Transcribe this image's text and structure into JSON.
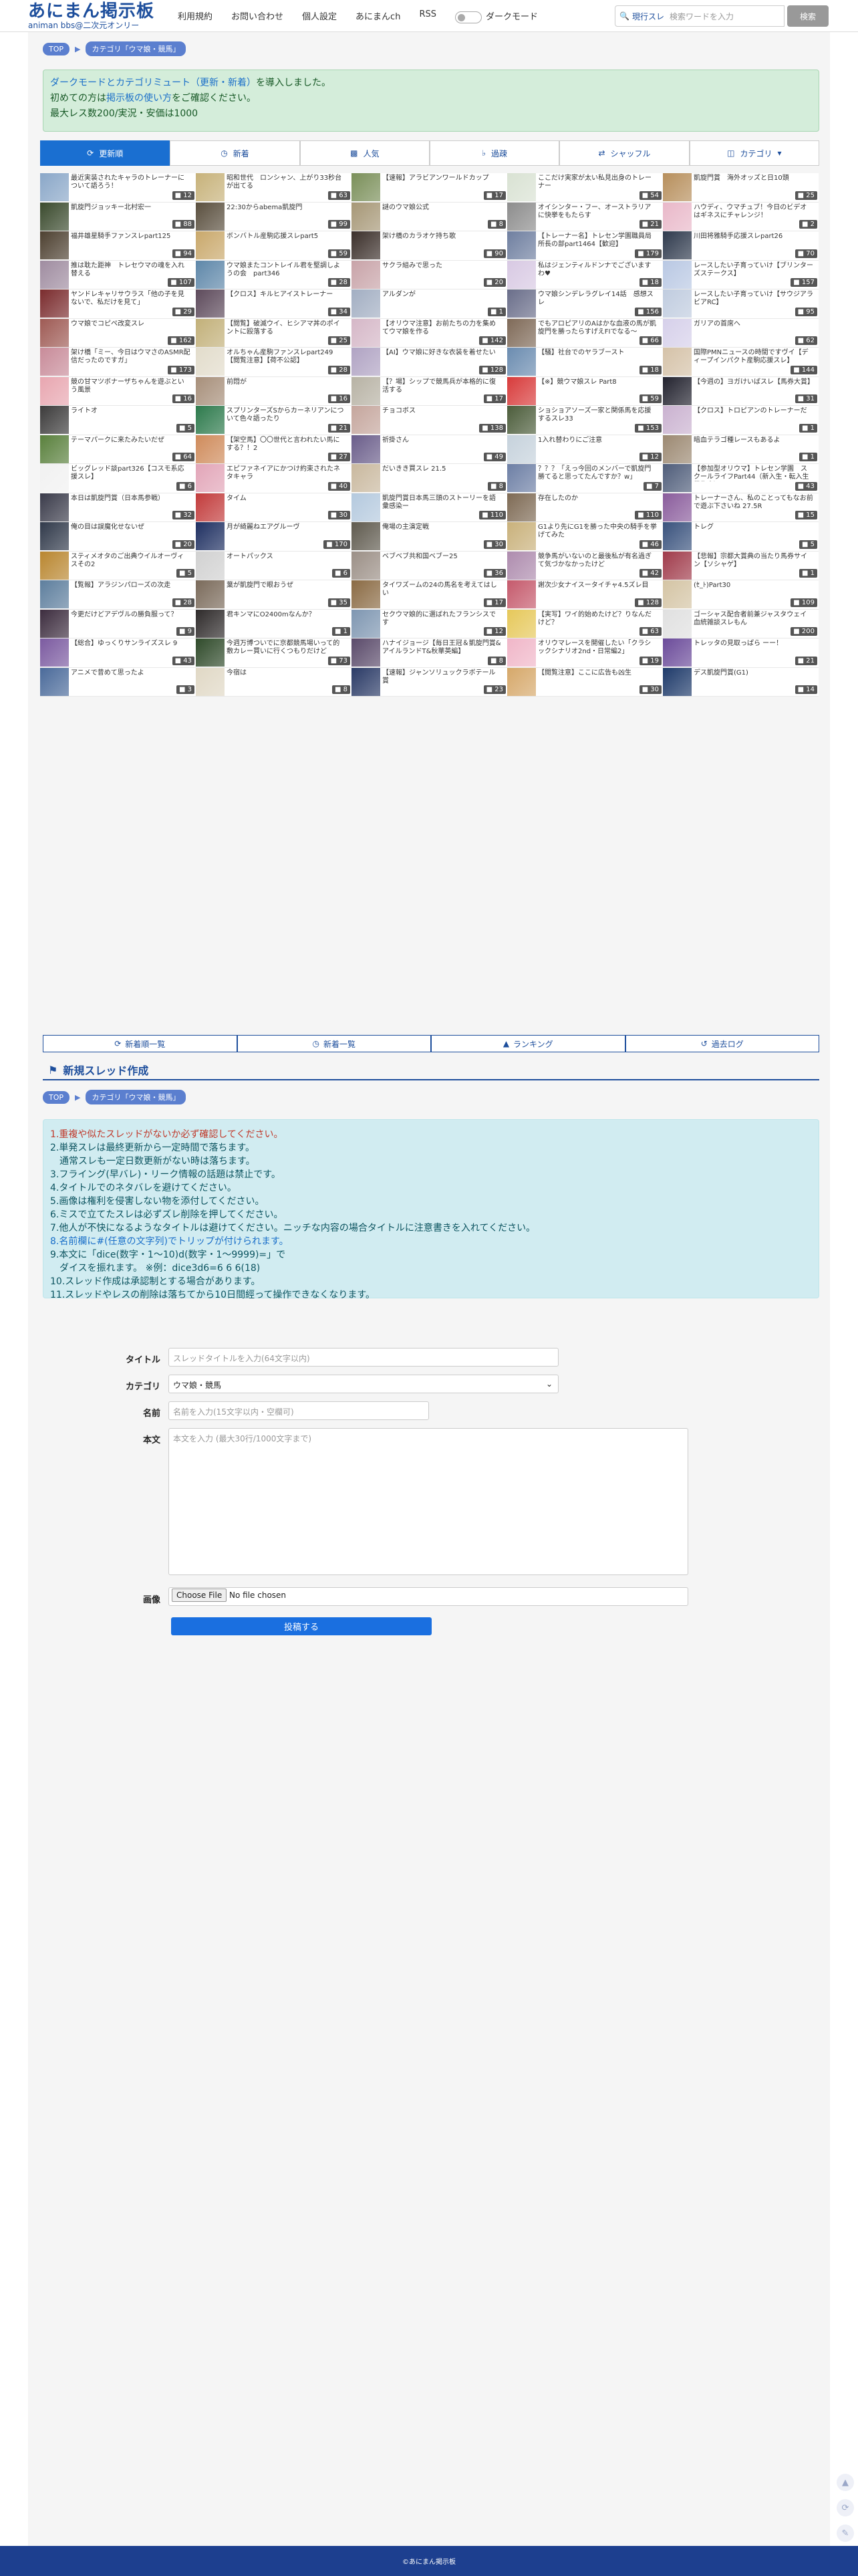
{
  "header": {
    "logo_title": "あにまん掲示板",
    "logo_sub": "animan bbs@二次元オンリー",
    "nav": [
      "利用規約",
      "お問い合わせ",
      "個人設定",
      "あにまんch",
      "RSS"
    ],
    "dark_mode": "ダークモード",
    "search_mode": "現行スレ",
    "search_placeholder": "検索ワードを入力",
    "search_button": "検索"
  },
  "breadcrumb": {
    "top": "TOP",
    "category": "カテゴリ「ウマ娘・競馬」"
  },
  "notice": {
    "l1a": "ダークモードとカテゴリミュート（更新・新着）",
    "l1b": "を導入しました。",
    "l2a": "初めての方は",
    "l2b": "掲示板の使い方",
    "l2c": "をご確認ください。",
    "l3": "最大レス数200/実況・安価は1000"
  },
  "tabs": [
    "更新順",
    "新着",
    "人気",
    "過疎",
    "シャッフル",
    "カテゴリ"
  ],
  "threads": [
    {
      "t": "最近実装されたキャラのトレーナーについて語ろう！",
      "c": "12",
      "h": "#8aa7c8"
    },
    {
      "t": "昭和世代　ロンシャン、上がり33秒台が出てる",
      "c": "63",
      "h": "#c7b27a"
    },
    {
      "t": "【速報】アラビアンワールドカップ",
      "c": "17",
      "h": "#7a8f59"
    },
    {
      "t": "ここだけ実家が太い私見出身のトレーナー",
      "c": "54",
      "h": "#d9e2d3"
    },
    {
      "t": "凱旋門賞　海外オッズと日10頭",
      "c": "25",
      "h": "#b78f5c"
    },
    {
      "t": "凱旋門ジョッキー北村宏一",
      "c": "88",
      "h": "#3a4a2d"
    },
    {
      "t": "22:30からabema凱旋門",
      "c": "99",
      "h": "#5a4f3e"
    },
    {
      "t": "謎のウマ娘公式",
      "c": "8",
      "h": "#a69776"
    },
    {
      "t": "オイシンター・フー、オーストラリアに快挙をもたらす",
      "c": "21",
      "h": "#8d8d8d"
    },
    {
      "t": "ハウディ、ウマチュブ！今日のビデオはギネスにチャレンジ！",
      "c": "2",
      "h": "#e9b8c9"
    },
    {
      "t": "福井雄星騎手ファンスレpart125",
      "c": "94",
      "h": "#4d4030"
    },
    {
      "t": "ボンバトル産駒応援スレpart5",
      "c": "59",
      "h": "#c9a86b"
    },
    {
      "t": "架け橋のカラオケ持ち歌",
      "c": "90",
      "h": "#3b2f2a"
    },
    {
      "t": "【トレーナー名】トレセン学園職員局所長の部part1464【歓迎】",
      "c": "179",
      "h": "#6f7fa0"
    },
    {
      "t": "川田将雅騎手応援スレpart26",
      "c": "70",
      "h": "#2f3a4d"
    },
    {
      "t": "推は耽た距神　トレセウマの魂を入れ替える",
      "c": "107",
      "h": "#9f8ca0"
    },
    {
      "t": "ウマ娘またコントレイル君を堅調しようの会　part346",
      "c": "28",
      "h": "#5e87a9"
    },
    {
      "t": "サクラ組みで思った",
      "c": "20",
      "h": "#c8a3a8"
    },
    {
      "t": "私はジェンティルドンナでございますわ♥",
      "c": "18",
      "h": "#d8c9e3"
    },
    {
      "t": "レースしたい子育っていけ【ブリンターズステークス】",
      "c": "157",
      "h": "#b9c8e3"
    },
    {
      "t": "ヤンドレキャリサウラス「他の子を見ないで、私だけを見て」",
      "c": "29",
      "h": "#7a2b2d"
    },
    {
      "t": "【クロス】キルヒアイストレーナー",
      "c": "34",
      "h": "#5d4a5b"
    },
    {
      "t": "アルダンが",
      "c": "1",
      "h": "#a2aec2"
    },
    {
      "t": "ウマ娘シンデレラグレイ14話　感想スレ",
      "c": "156",
      "h": "#6a6e8a"
    },
    {
      "t": "レースしたい子育っていけ【サウジアラビアRC】",
      "c": "95",
      "h": "#c0ccdf"
    },
    {
      "t": "ウマ娘でコピペ改変スレ",
      "c": "162",
      "h": "#9e5a54"
    },
    {
      "t": "【閲覧】破滅ウイ、ヒシアマ丼のポイントに殴落する",
      "c": "25",
      "h": "#c2b079"
    },
    {
      "t": "【オリウマ注意】お前たちの力を集めてウマ娘を作る",
      "c": "142",
      "h": "#d5b7c7"
    },
    {
      "t": "でもアロピアリのAはかな血液の馬が凱旋門を勝ったらすげえFIでなる～",
      "c": "66",
      "h": "#7f6a58"
    },
    {
      "t": "ガリアの首席へ",
      "c": "62",
      "h": "#d6d0ea"
    },
    {
      "t": "架け橋「ミー、今日はウマさのASMR配信だったのですガ」",
      "c": "173",
      "h": "#c88b99"
    },
    {
      "t": "オルちゃん産駒ファンスレpart249【閲覧注意】【荷不公認】",
      "c": "28",
      "h": "#e2dccb"
    },
    {
      "t": "【AI】ウマ娘に好きな衣装を着せたい",
      "c": "128",
      "h": "#b0a3c3"
    },
    {
      "t": "【騒】社台でのヤラブースト",
      "c": "18",
      "h": "#6b8cb0"
    },
    {
      "t": "国際PMNニュースの時間ですヴイ【ディープインパクト産駒応援スレ】 part103",
      "c": "144",
      "h": "#d5c2a8"
    },
    {
      "t": "競の甘マツボナーザちゃんを遊ぶという風景",
      "c": "16",
      "h": "#e8a6b0"
    },
    {
      "t": "前悶が",
      "c": "16",
      "h": "#a78f7a"
    },
    {
      "t": "【？場】シップで競馬兵が本格的に復活する",
      "c": "17",
      "h": "#b7b2a4"
    },
    {
      "t": "【※】競ウマ娘スレ Part8",
      "c": "59",
      "h": "#d83b3b"
    },
    {
      "t": "【今週の】ヨガけいばスレ【馬券大賞】",
      "c": "31",
      "h": "#22222e"
    },
    {
      "t": "ライトオ",
      "c": "5",
      "h": "#3c3b3b"
    },
    {
      "t": "スプリンターズSからカーネリアンについて色々語ったり",
      "c": "21",
      "h": "#2d7a4c"
    },
    {
      "t": "チョコボス",
      "c": "138",
      "h": "#c5a69d"
    },
    {
      "t": "ショショアソーズ一家と関係馬を応援するスレ33",
      "c": "153",
      "h": "#4c5d3b"
    },
    {
      "t": "【クロス】トロピアンのトレーナーだ",
      "c": "1",
      "h": "#cab2d0"
    },
    {
      "t": "テーマパークに来たみたいだぜ",
      "c": "64",
      "h": "#59803c"
    },
    {
      "t": "【架空馬】〇〇世代と言われたい馬にする？！2",
      "c": "27",
      "h": "#cf8b5b"
    },
    {
      "t": "祈掛さん",
      "c": "49",
      "h": "#6a5d8a"
    },
    {
      "t": "1入れ替わりにご注意",
      "c": "12",
      "h": "#c6d2dc"
    },
    {
      "t": "暗血テラゴ種レースもあるよ",
      "c": "1",
      "h": "#9c8972"
    },
    {
      "t": "ビッグレッド談part326【コスモ系応援スレ】",
      "c": "6",
      "h": "#f1f1f1"
    },
    {
      "t": "エピファネイアにかつけ約束されたネタキャラ",
      "c": "40",
      "h": "#e2a5b8"
    },
    {
      "t": "だいきき買スレ 21.5",
      "c": "8",
      "h": "#c9b89e"
    },
    {
      "t": "？？？「えっ今回のメンバーで凱旋門勝てると思ってたんですか？w」",
      "c": "7",
      "h": "#6d7fa5"
    },
    {
      "t": "【参加型オリウマ】トレセン学園　スクールライフPart44（新入生・転入生募集中）",
      "c": "43",
      "h": "#4f5d7a"
    },
    {
      "t": "本日は凱旋門賞（日本馬参戦）",
      "c": "32",
      "h": "#3a3b4a"
    },
    {
      "t": "タイム",
      "c": "30",
      "h": "#c23b3b"
    },
    {
      "t": "凱旋門賞日本馬三頭のストーリーを語彙感染ー",
      "c": "110",
      "h": "#b4c9de"
    },
    {
      "t": "存在したのか",
      "c": "110",
      "h": "#7e6a54"
    },
    {
      "t": "トレーナーさん、私のことってもなお前で遊ぶ下さいね 27.5R",
      "c": "15",
      "h": "#8a5c9c"
    },
    {
      "t": "俺の目は誤魔化せないぜ",
      "c": "20",
      "h": "#30394a"
    },
    {
      "t": "月が綺麗ねエアグルーヴ",
      "c": "170",
      "h": "#1e2f61"
    },
    {
      "t": "俺場の主演定戦",
      "c": "30",
      "h": "#5f5a4e"
    },
    {
      "t": "G1より先にG1を勝った中央の騎手を挙げてみた",
      "c": "46",
      "h": "#c9b17b"
    },
    {
      "t": "トレグ",
      "c": "5",
      "h": "#39527d"
    },
    {
      "t": "スティメオタのご出典ウイルオーヴィスその2",
      "c": "5",
      "h": "#b9862f"
    },
    {
      "t": "オートパックス",
      "c": "6",
      "h": "#d1d1d1"
    },
    {
      "t": "ベブベブ共和国ベブー25",
      "c": "36",
      "h": "#9b8f86"
    },
    {
      "t": "競争馬がいないのと最後私が有名過ぎて気づかなかったけど",
      "c": "42",
      "h": "#ae8cae"
    },
    {
      "t": "【悲報】宗都大賞典の当たり馬券サイン【ソシャゲ】",
      "c": "1",
      "h": "#a03b4b"
    },
    {
      "t": "【覧報】アラジンパローズの次走",
      "c": "28",
      "h": "#5d7e9d"
    },
    {
      "t": "葉が凱旋門で眼おうぜ",
      "c": "35",
      "h": "#7a6a5a"
    },
    {
      "t": "タイワズームの24の馬名を考えてはしい",
      "c": "17",
      "h": "#8a6a43"
    },
    {
      "t": "謝次少女ナイスータイチャ4.5ズレ目",
      "c": "128",
      "h": "#c55a6c"
    },
    {
      "t": "(ｾ_ﾄ)Part30",
      "c": "109",
      "h": "#d4c4a4"
    },
    {
      "t": "今更だけどアデヴルの勝負服って？",
      "c": "9",
      "h": "#3c2c3e"
    },
    {
      "t": "君キンマにO2400mなんか？",
      "c": "1",
      "h": "#2e2a2a"
    },
    {
      "t": "セクウマ娘的に選ばれたフランシスです",
      "c": "12",
      "h": "#7e96b1"
    },
    {
      "t": "【実写】ワイ的始めたけど？りなんだけど？",
      "c": "63",
      "h": "#e6c85a"
    },
    {
      "t": "ゴーシャス配合者前兼ジャスタウェイ血統雑談スレもん",
      "c": "200",
      "h": "#e0e0e0"
    },
    {
      "t": "【総合】ゆっくりサンライズスレ 9",
      "c": "43",
      "h": "#7b5aa0"
    },
    {
      "t": "今週万博ついでに京都競馬場いって的敷カレー買いに行くつもりだけど",
      "c": "73",
      "h": "#2f4a2a"
    },
    {
      "t": "ハナイジョージ【毎日王冠＆凱旋門賞&アイルランドT&秋華英編】",
      "c": "8",
      "h": "#5a4a6a"
    },
    {
      "t": "オリウマレースを開催したい「クラシックシナリオ2nd・日常編2」",
      "c": "19",
      "h": "#f0b6c8"
    },
    {
      "t": "トレッタの見取っぱら ーー！",
      "c": "21",
      "h": "#6b4b9a"
    },
    {
      "t": "アニメで昔めて思ったよ",
      "c": "3",
      "h": "#4a6a9a"
    },
    {
      "t": "今宿は",
      "c": "8",
      "h": "#e0d8c5"
    },
    {
      "t": "【速報】ジャンソリュックラボテール賞",
      "c": "23",
      "h": "#2a3a66"
    },
    {
      "t": "【閲覧注意】ここに広告も凶生",
      "c": "30",
      "h": "#d6a86a"
    },
    {
      "t": "デス凱旋門賞(G1)",
      "c": "14",
      "h": "#1e3a6a"
    }
  ],
  "bottom_nav": [
    "新着順一覧",
    "新着一覧",
    "ランキング",
    "過去ログ"
  ],
  "new_thread": {
    "heading": "新規スレッド作成",
    "rules": [
      "1.重複や似たスレッドがないか必ず確認してください。",
      "2.単発スレは最終更新から一定時間で落ちます。",
      "　通常スレも一定日数更新がない時は落ちます。",
      "3.フライング(早バレ)・リーク情報の話題は禁止です。",
      "4.タイトルでのネタバレを避けてください。",
      "5.画像は権利を侵害しない物を添付してください。",
      "6.ミスで立てたスレは必ずズレ削除を押してください。",
      "7.他人が不快になるようなタイトルは避けてください。ニッチな内容の場合タイトルに注意書きを入れてください。",
      "8.名前欄に#(任意の文字列)でトリップが付けられます。",
      "9.本文に「dice(数字・1〜10)d(数字・1〜9999)=」で",
      "　ダイスを振れます。 ※例：dice3d6=6 6 6(18)",
      "10.スレッド作成は承認制とする場合があります。",
      "11.スレッドやレスの削除は落ちてから10日間經って操作できなくなります。"
    ],
    "title_label": "タイトル",
    "title_ph": "スレッドタイトルを入力(64文字以内)",
    "category_label": "カテゴリ",
    "category_value": "ウマ娘・競馬",
    "name_label": "名前",
    "name_ph": "名前を入力(15文字以内・空欄可)",
    "body_label": "本文",
    "body_ph": "本文を入力 (最大30行/1000文字まで)",
    "image_label": "画像",
    "file_button": "Choose File",
    "file_none": "No file chosen",
    "submit": "投稿する"
  },
  "footer": "©あにまん掲示板"
}
